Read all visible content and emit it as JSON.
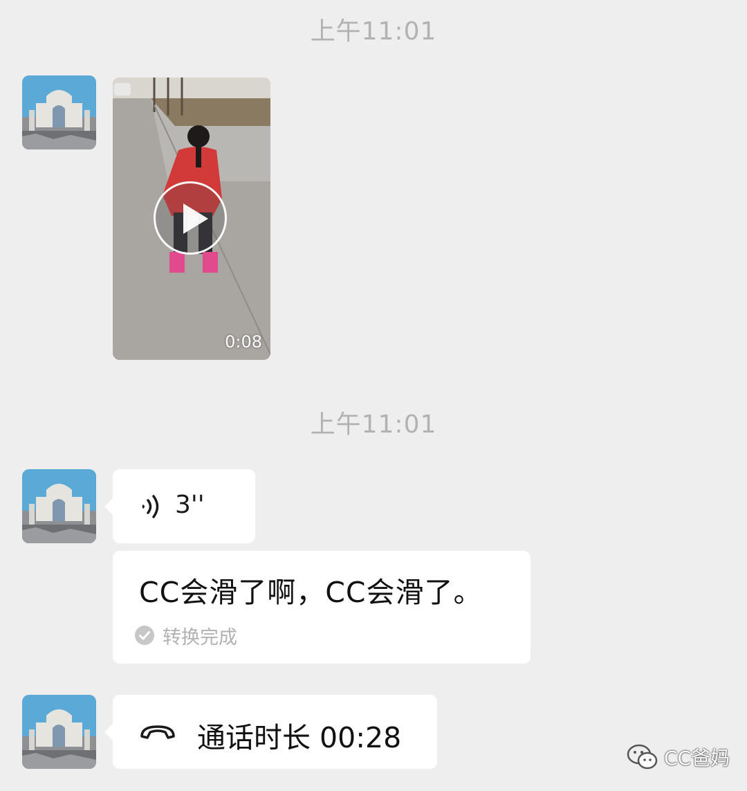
{
  "chat": {
    "timestamp_1": "上午11:01",
    "timestamp_2": "上午11:01",
    "video": {
      "duration": "0:08",
      "icon": "play-icon"
    },
    "voice": {
      "length": "3''",
      "icon": "voice-wave-icon"
    },
    "transcript": {
      "text": "CC会滑了啊，CC会滑了。",
      "status": "转换完成",
      "status_icon": "check-circle-icon"
    },
    "call": {
      "text": "通话时长 00:28",
      "icon": "phone-hangup-icon"
    }
  },
  "watermark": {
    "text": "CC爸妈",
    "icon": "wechat-icon"
  },
  "colors": {
    "background": "#eeeeee",
    "bubble": "#ffffff",
    "timestamp": "#b2b2b2"
  }
}
